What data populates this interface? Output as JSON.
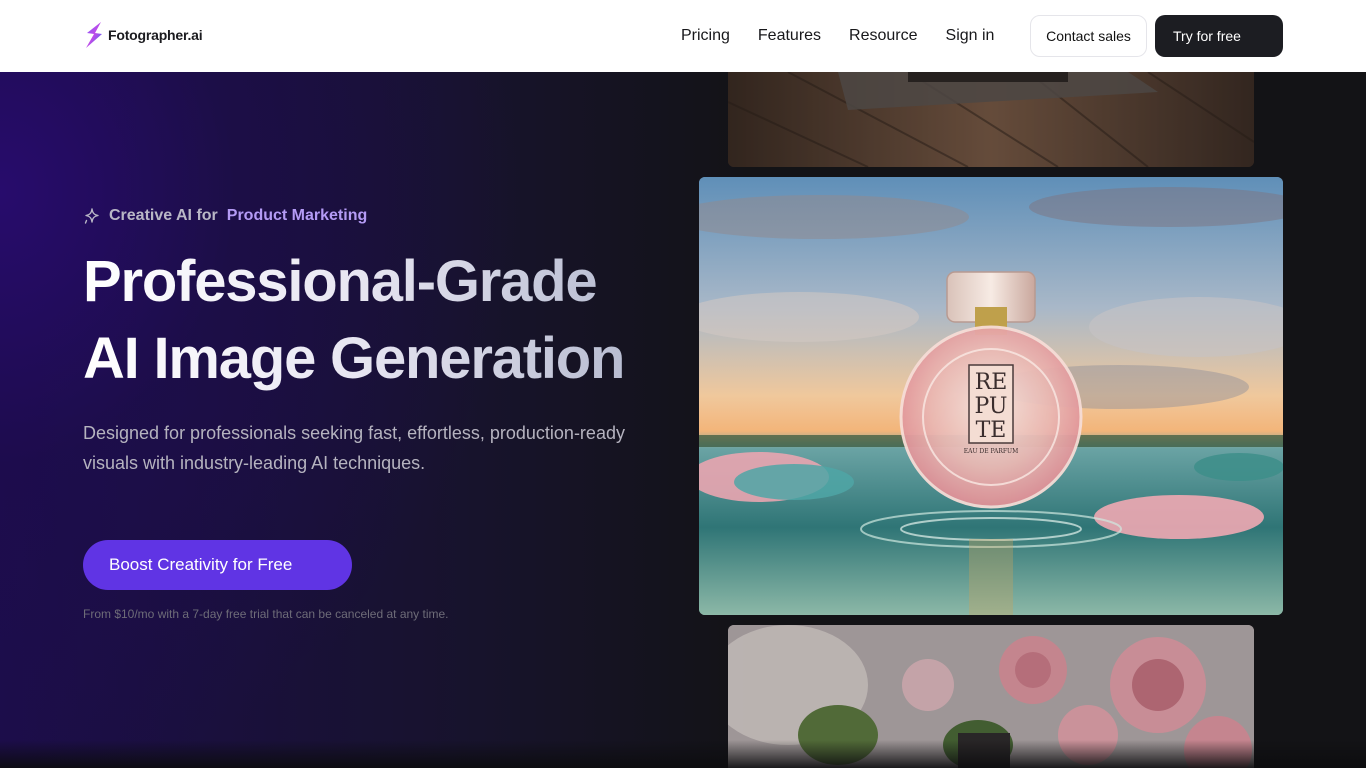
{
  "nav": {
    "logo_text": "Fotographer.ai",
    "links": [
      {
        "label": "Pricing"
      },
      {
        "label": "Features"
      },
      {
        "label": "Resource"
      },
      {
        "label": "Sign in"
      }
    ],
    "contact_label": "Contact sales",
    "try_label": "Try for free"
  },
  "hero": {
    "eyebrow_static": "Creative AI for",
    "eyebrow_accent": "Product Marketing",
    "headline_line1": "Professional-Grade",
    "headline_line2": "AI Image Generation",
    "subtext": "Designed for professionals seeking fast, effortless, production-ready visuals with industry-leading AI techniques.",
    "cta_label": "Boost Creativity for Free",
    "fineprint": "From $10/mo with a 7-day free trial that can be canceled at any time."
  },
  "images": {
    "main_bottle_label": "REPUTE",
    "main_bottle_sub": "EAU DE PARFUM"
  },
  "colors": {
    "accent": "#6034e4",
    "eyebrow_accent": "#b49bf5",
    "dark_button": "#1c1d22"
  }
}
